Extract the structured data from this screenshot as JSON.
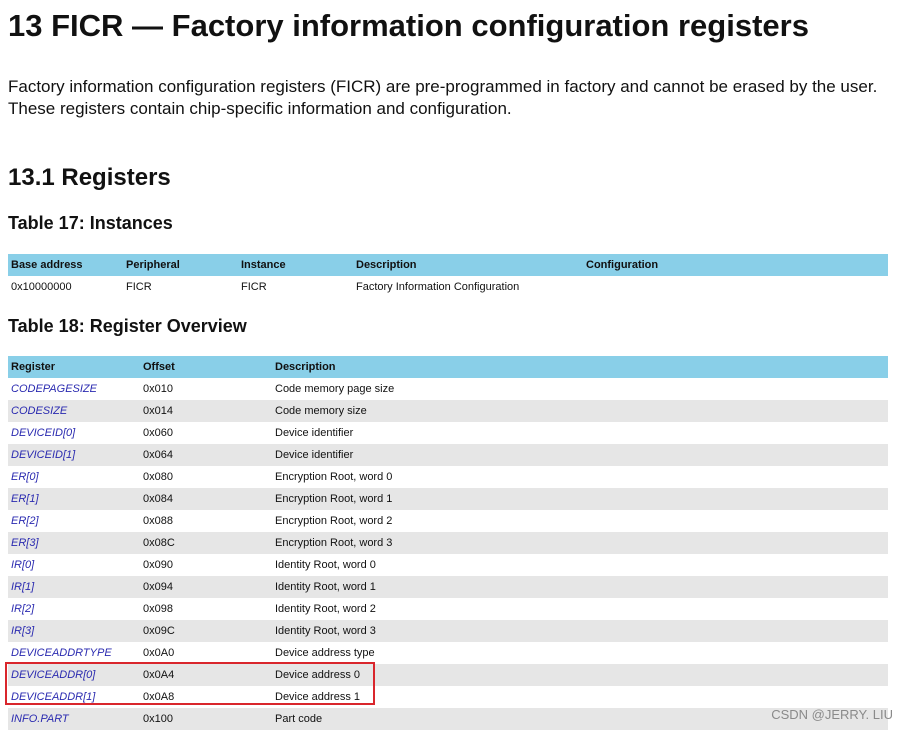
{
  "document": {
    "title": "13 FICR — Factory information configuration registers",
    "intro": "Factory information configuration registers (FICR) are pre-programmed in factory and cannot be erased by the user. These registers contain chip-specific information and configuration.",
    "section_title": "13.1 Registers"
  },
  "table17": {
    "caption": "Table 17: Instances",
    "headers": [
      "Base address",
      "Peripheral",
      "Instance",
      "Description",
      "Configuration"
    ],
    "rows": [
      [
        "0x10000000",
        "FICR",
        "FICR",
        "Factory Information Configuration",
        ""
      ]
    ]
  },
  "table18": {
    "caption": "Table 18: Register Overview",
    "headers": [
      "Register",
      "Offset",
      "Description"
    ],
    "rows": [
      [
        "CODEPAGESIZE",
        "0x010",
        "Code memory page size"
      ],
      [
        "CODESIZE",
        "0x014",
        "Code memory size"
      ],
      [
        "DEVICEID[0]",
        "0x060",
        "Device identifier"
      ],
      [
        "DEVICEID[1]",
        "0x064",
        "Device identifier"
      ],
      [
        "ER[0]",
        "0x080",
        "Encryption Root, word 0"
      ],
      [
        "ER[1]",
        "0x084",
        "Encryption Root, word 1"
      ],
      [
        "ER[2]",
        "0x088",
        "Encryption Root, word 2"
      ],
      [
        "ER[3]",
        "0x08C",
        "Encryption Root, word 3"
      ],
      [
        "IR[0]",
        "0x090",
        "Identity Root, word 0"
      ],
      [
        "IR[1]",
        "0x094",
        "Identity Root, word 1"
      ],
      [
        "IR[2]",
        "0x098",
        "Identity Root, word 2"
      ],
      [
        "IR[3]",
        "0x09C",
        "Identity Root, word 3"
      ],
      [
        "DEVICEADDRTYPE",
        "0x0A0",
        "Device address type"
      ],
      [
        "DEVICEADDR[0]",
        "0x0A4",
        "Device address 0"
      ],
      [
        "DEVICEADDR[1]",
        "0x0A8",
        "Device address 1"
      ],
      [
        "INFO.PART",
        "0x100",
        "Part code"
      ]
    ]
  },
  "watermark": "CSDN @JERRY. LIU",
  "colors": {
    "header_bg": "#89cfe8",
    "row_alt_bg": "#e6e6e6",
    "link": "#2a2ab0",
    "highlight": "#d9262c"
  }
}
